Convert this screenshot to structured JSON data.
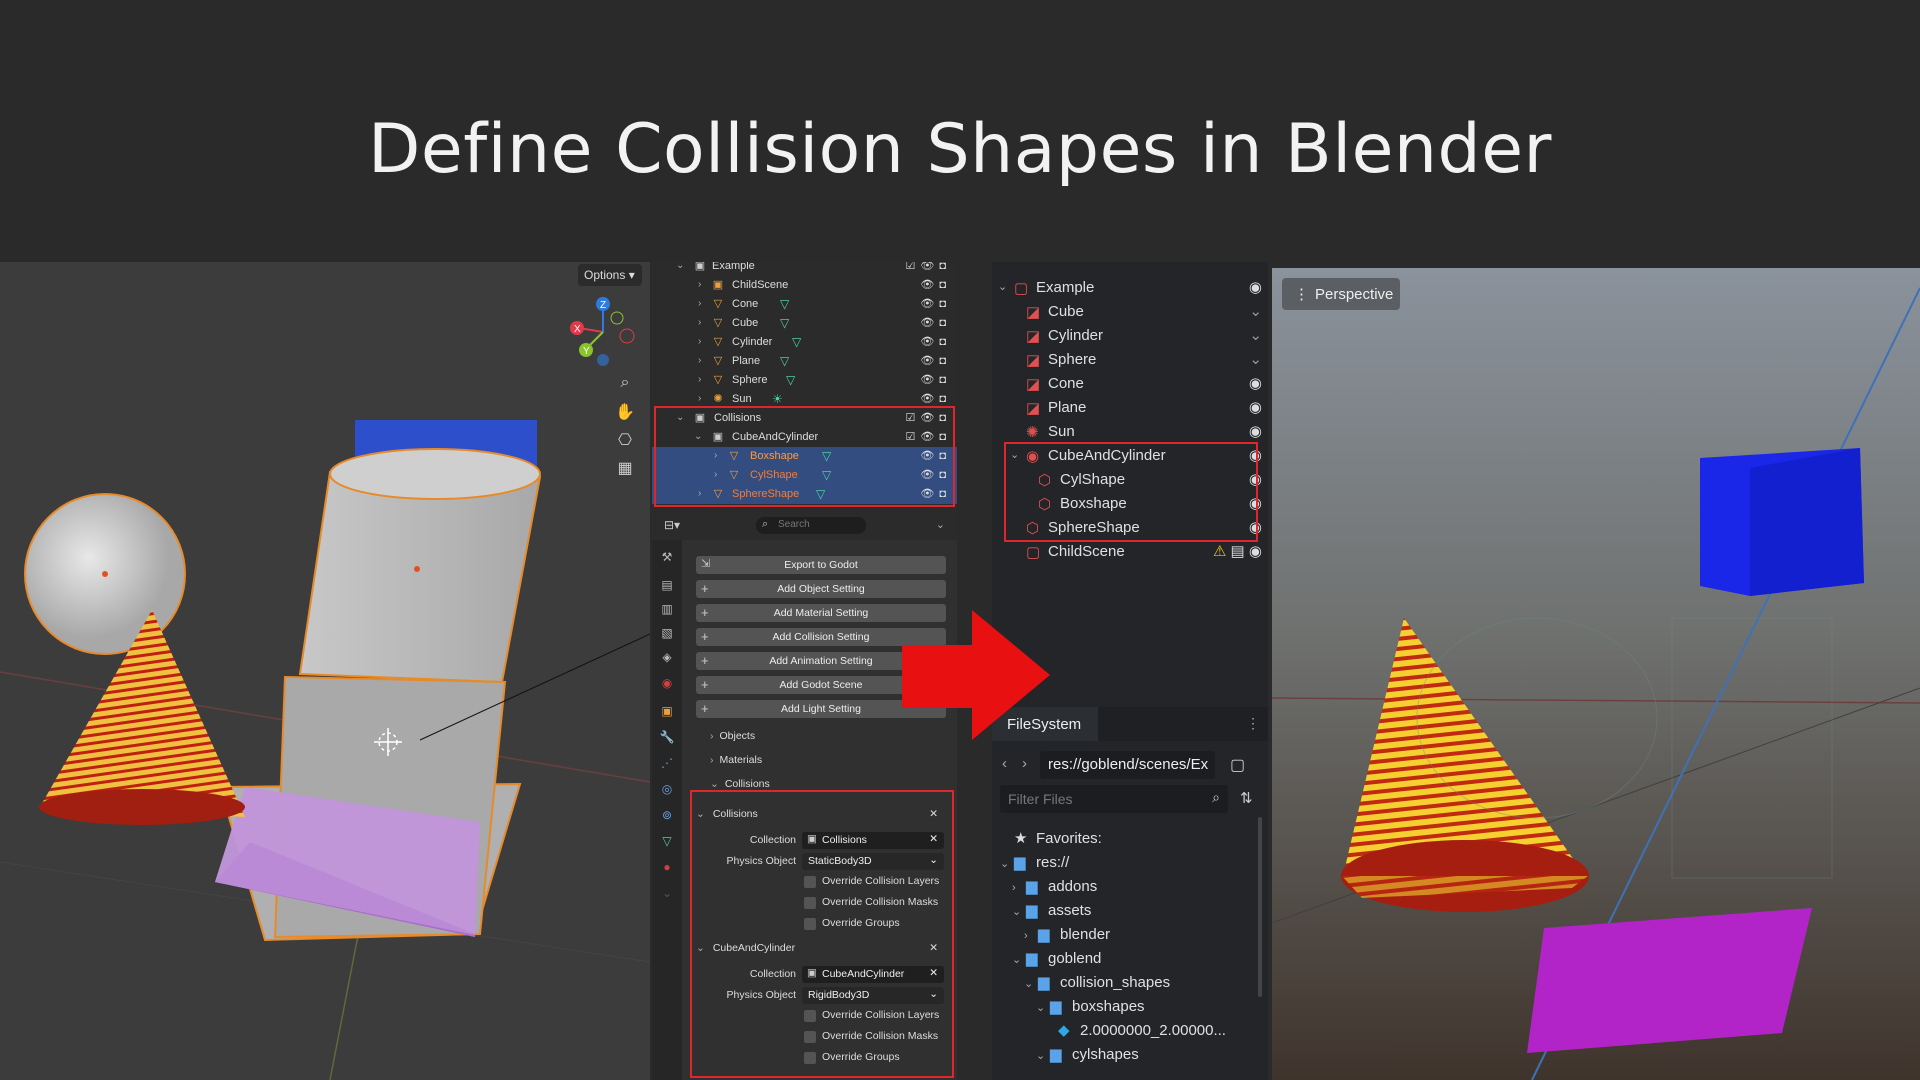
{
  "title": "Define Collision Shapes in Blender",
  "blender_viewport": {
    "options_label": "Options",
    "nav_icons": [
      "zoom-icon",
      "hand-icon",
      "camera-icon",
      "grid-icon"
    ],
    "gizmo_labels": {
      "x": "X",
      "y": "Y",
      "z": "Z"
    }
  },
  "blender_outliner": {
    "rows": [
      {
        "label": "Example",
        "depth": 0,
        "icon": "collection"
      },
      {
        "label": "ChildScene",
        "depth": 1,
        "icon": "collection"
      },
      {
        "label": "Cone",
        "depth": 1,
        "icon": "object"
      },
      {
        "label": "Cube",
        "depth": 1,
        "icon": "object"
      },
      {
        "label": "Cylinder",
        "depth": 1,
        "icon": "object"
      },
      {
        "label": "Plane",
        "depth": 1,
        "icon": "object"
      },
      {
        "label": "Sphere",
        "depth": 1,
        "icon": "object"
      },
      {
        "label": "Sun",
        "depth": 1,
        "icon": "light"
      },
      {
        "label": "Collisions",
        "depth": 0,
        "icon": "collection"
      },
      {
        "label": "CubeAndCylinder",
        "depth": 1,
        "icon": "collection"
      },
      {
        "label": "Boxshape",
        "depth": 2,
        "icon": "object"
      },
      {
        "label": "CylShape",
        "depth": 2,
        "icon": "object"
      },
      {
        "label": "SphereShape",
        "depth": 1,
        "icon": "object"
      }
    ]
  },
  "blender_properties": {
    "search_placeholder": "Search",
    "buttons": [
      "Export to Godot",
      "Add Object Setting",
      "Add Material Setting",
      "Add Collision Setting",
      "Add Animation Setting",
      "Add Godot Scene",
      "Add Light Setting"
    ],
    "subpanels": [
      "Objects",
      "Materials",
      "Collisions"
    ],
    "sections": [
      {
        "header": "Collisions",
        "collection_label": "Collection",
        "collection_value": "Collisions",
        "physics_label": "Physics Object",
        "physics_value": "StaticBody3D",
        "options": [
          "Override Collision Layers",
          "Override Collision Masks",
          "Override Groups"
        ]
      },
      {
        "header": "CubeAndCylinder",
        "collection_label": "Collection",
        "collection_value": "CubeAndCylinder",
        "physics_label": "Physics Object",
        "physics_value": "RigidBody3D",
        "options": [
          "Override Collision Layers",
          "Override Collision Masks",
          "Override Groups"
        ]
      }
    ]
  },
  "godot_scene_tree": {
    "rows": [
      {
        "label": "Example",
        "depth": 0
      },
      {
        "label": "Cube",
        "depth": 1
      },
      {
        "label": "Cylinder",
        "depth": 1
      },
      {
        "label": "Sphere",
        "depth": 1
      },
      {
        "label": "Cone",
        "depth": 1
      },
      {
        "label": "Plane",
        "depth": 1
      },
      {
        "label": "Sun",
        "depth": 1
      },
      {
        "label": "CubeAndCylinder",
        "depth": 1
      },
      {
        "label": "CylShape",
        "depth": 2
      },
      {
        "label": "Boxshape",
        "depth": 2
      },
      {
        "label": "SphereShape",
        "depth": 1
      },
      {
        "label": "ChildScene",
        "depth": 1
      }
    ]
  },
  "godot_filesystem": {
    "tab_label": "FileSystem",
    "path": "res://goblend/scenes/Ex",
    "filter_placeholder": "Filter Files",
    "favorites": "Favorites:",
    "rows": [
      {
        "label": "res://",
        "depth": 0
      },
      {
        "label": "addons",
        "depth": 1
      },
      {
        "label": "assets",
        "depth": 1
      },
      {
        "label": "blender",
        "depth": 2
      },
      {
        "label": "goblend",
        "depth": 1
      },
      {
        "label": "collision_shapes",
        "depth": 2
      },
      {
        "label": "boxshapes",
        "depth": 3
      },
      {
        "label": "2.0000000_2.00000...",
        "depth": 4
      },
      {
        "label": "cylshapes",
        "depth": 3
      }
    ]
  },
  "godot_viewport": {
    "perspective_label": "Perspective"
  },
  "colors": {
    "highlight_red": "#e0262c",
    "selection_blue": "#334d80",
    "arrow_red": "#e81010"
  }
}
